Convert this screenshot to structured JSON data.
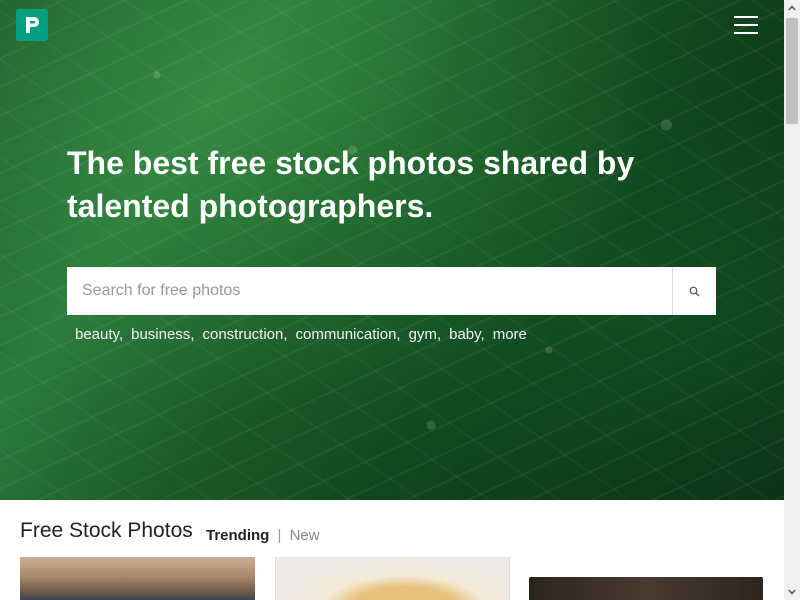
{
  "header": {
    "logo_icon": "pexels-logo-icon",
    "brand_color": "#05a081",
    "menu_icon": "hamburger-menu-icon"
  },
  "hero": {
    "headline": "The best free stock photos shared by talented photographers.",
    "search": {
      "placeholder": "Search for free photos",
      "button_icon": "search-icon"
    },
    "tags": [
      "beauty",
      "business",
      "construction",
      "communication",
      "gym",
      "baby",
      "more"
    ]
  },
  "content": {
    "section_title": "Free Stock Photos",
    "filters": {
      "trending": "Trending",
      "divider": "|",
      "new": "New"
    }
  },
  "scrollbar": {
    "up_icon": "chevron-up-icon",
    "down_icon": "chevron-down-icon"
  }
}
